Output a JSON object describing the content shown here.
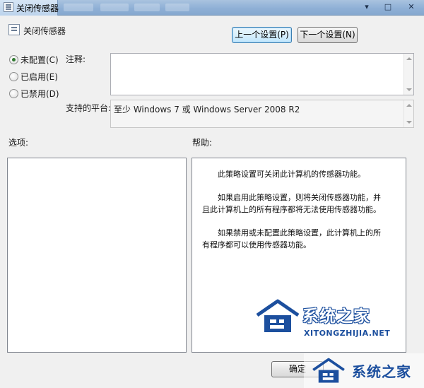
{
  "window": {
    "title": "关闭传感器",
    "minimize_glyph": "▾",
    "maximize_glyph": "□",
    "close_glyph": "✕"
  },
  "header": {
    "policy_title": "关闭传感器",
    "prev_button": "上一个设置(P)",
    "next_button": "下一个设置(N)"
  },
  "state": {
    "options": [
      {
        "label": "未配置(C)",
        "checked": true
      },
      {
        "label": "已启用(E)",
        "checked": false
      },
      {
        "label": "已禁用(D)",
        "checked": false
      }
    ]
  },
  "comment": {
    "label": "注释:",
    "value": ""
  },
  "platform": {
    "label": "支持的平台:",
    "value": "至少 Windows 7 或 Windows Server 2008 R2"
  },
  "options_pane": {
    "label": "选项:"
  },
  "help_pane": {
    "label": "帮助:",
    "paragraphs": [
      "此策略设置可关闭此计算机的传感器功能。",
      "如果启用此策略设置，则将关闭传感器功能，并且此计算机上的所有程序都将无法使用传感器功能。",
      "如果禁用或未配置此策略设置，此计算机上的所有程序都可以使用传感器功能。"
    ]
  },
  "footer": {
    "ok_button": "确定"
  },
  "watermark": {
    "text_cn": "系统之家",
    "text_en": "XITONGZHIJIA.NET",
    "color": "#1c4f9e"
  }
}
